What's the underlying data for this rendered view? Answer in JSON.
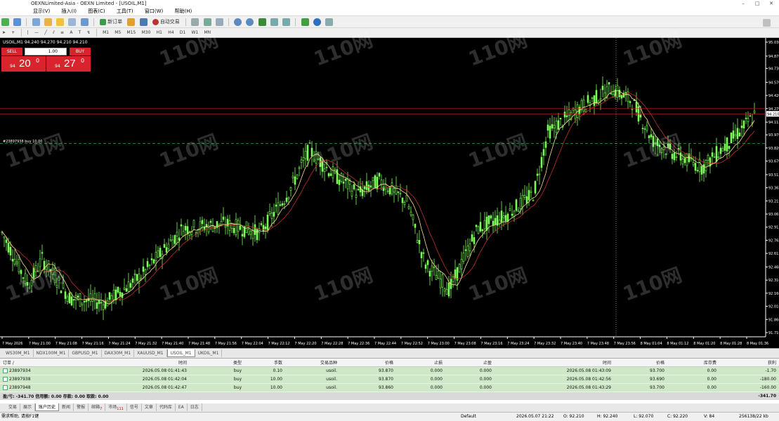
{
  "window": {
    "title": "OEXNLimited-Asia - OEXN Limited - [USOIL,M1]"
  },
  "menu": [
    "显示(V)",
    "插入(I)",
    "图表(C)",
    "工具(T)",
    "窗口(W)",
    "帮助(H)"
  ],
  "toolbar": {
    "new_order": "新订单",
    "auto_trade": "自动交易"
  },
  "timeframes": [
    "M1",
    "M5",
    "M15",
    "M30",
    "H1",
    "H4",
    "D1",
    "W1",
    "MN"
  ],
  "chart": {
    "header": "USOIL,M1  94.240 94.270 94.210 94.210",
    "sell_label": "SELL",
    "buy_label": "BUY",
    "lots": "1.00",
    "sell_price_small": "94",
    "sell_price_big": "20",
    "sell_price_sup": "0",
    "buy_price_small": "94",
    "buy_price_big": "27",
    "buy_price_sup": "0",
    "order_line_label": "#23897938 buy 10.00",
    "current_price_label": "94.210",
    "price_ticks": [
      "95.030",
      "94.870",
      "94.730",
      "94.570",
      "94.420",
      "94.270",
      "94.115",
      "93.970",
      "93.820",
      "93.670",
      "93.515",
      "93.365",
      "93.215",
      "93.065",
      "92.915",
      "92.765",
      "92.615",
      "92.460",
      "92.310",
      "92.160",
      "92.010",
      "91.860",
      "91.710"
    ],
    "time_ticks": [
      "7 May 2026",
      "7 May 21:00",
      "7 May 21:08",
      "7 May 21:16",
      "7 May 21:24",
      "7 May 21:32",
      "7 May 21:40",
      "7 May 21:48",
      "7 May 21:56",
      "7 May 22:04",
      "7 May 22:12",
      "7 May 22:20",
      "7 May 22:28",
      "7 May 22:36",
      "7 May 22:44",
      "7 May 22:52",
      "7 May 23:00",
      "7 May 23:08",
      "7 May 23:16",
      "7 May 23:24",
      "7 May 23:32",
      "7 May 23:40",
      "7 May 23:48",
      "7 May 23:56",
      "8 May 01:04",
      "8 May 01:12",
      "8 May 01:20",
      "8 May 01:28",
      "8 May 01:36"
    ],
    "watermark": "110网"
  },
  "chart_tabs": [
    "WS30M_M1",
    "NDX100M_M1",
    "GBPUSD_M1",
    "DAX30M_M1",
    "XAUUSD_M1",
    "USOIL_M1",
    "UKOIL_M1"
  ],
  "active_chart_tab": "USOIL_M1",
  "terminal": {
    "headers": [
      "订单 /",
      "时间",
      "类型",
      "手数",
      "交易品种",
      "价格",
      "止损",
      "止盈",
      "时间",
      "价格",
      "库存费",
      "获利"
    ],
    "rows": [
      [
        "23897934",
        "2026.05.08 01:41:43",
        "buy",
        "0.10",
        "usoil.",
        "93.870",
        "0.000",
        "0.000",
        "2026.05.08 01:43:09",
        "93.700",
        "0.00",
        "-1.70"
      ],
      [
        "23897938",
        "2026.05.08 01:42:04",
        "buy",
        "10.00",
        "usoil.",
        "93.870",
        "0.000",
        "0.000",
        "2026.05.08 01:42:56",
        "93.690",
        "0.00",
        "-180.00"
      ],
      [
        "23897948",
        "2026.05.08 01:42:47",
        "buy",
        "10.00",
        "usoil.",
        "93.860",
        "0.000",
        "0.000",
        "2026.05.08 01:43:29",
        "93.700",
        "0.00",
        "-160.00"
      ]
    ],
    "summary": "盈/亏: -341.70  信用额: 0.00  存款: 0.00  取款: 0.00",
    "summary_total": "-341.70"
  },
  "terminal_tabs": [
    {
      "label": "交易",
      "badge": ""
    },
    {
      "label": "展示",
      "badge": ""
    },
    {
      "label": "账户历史",
      "badge": ""
    },
    {
      "label": "新闻",
      "badge": ""
    },
    {
      "label": "警报",
      "badge": ""
    },
    {
      "label": "邮箱",
      "badge": "7"
    },
    {
      "label": "市场",
      "badge": "111"
    },
    {
      "label": "信号",
      "badge": ""
    },
    {
      "label": "文章",
      "badge": ""
    },
    {
      "label": "代码库",
      "badge": ""
    },
    {
      "label": "EA",
      "badge": ""
    },
    {
      "label": "日志",
      "badge": ""
    }
  ],
  "active_terminal_tab": "账户历史",
  "status": {
    "help": "需求帮助, 请按F1键",
    "profile": "Default",
    "datetime": "2026.05.07 21:22",
    "open": "O: 92.210",
    "high": "H: 92.240",
    "low": "L: 92.070",
    "close": "C: 92.220",
    "volume": "V: 84",
    "traffic": "256138/22 kb"
  },
  "colors": {
    "chart_bg": "#000000",
    "candle": "#7cfc5a",
    "ma_fast": "#ffe08a",
    "ma_slow": "#c0302a",
    "price_line": "#d01818",
    "sell_buy": "#d9232d",
    "row_bg": "#cfe8c8"
  }
}
